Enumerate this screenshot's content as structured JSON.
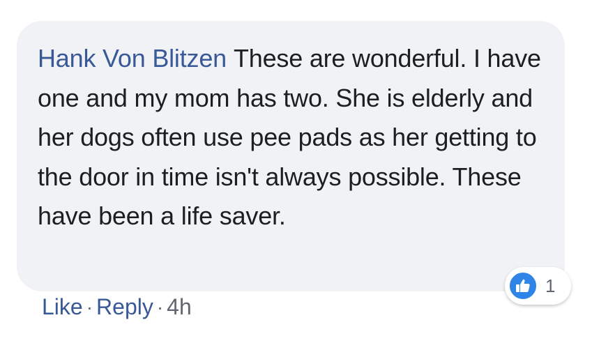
{
  "comment": {
    "author": "Hank Von Blitzen",
    "text": "These are wonderful. I have one and my mom has two. She is elderly and her dogs often use pee pads as her getting to the door in time isn't always possible. These have been a life saver."
  },
  "reactions": {
    "icon": "thumbs-up-icon",
    "count": "1",
    "color": "#2e84e7"
  },
  "actions": {
    "like_label": "Like",
    "separator": "·",
    "reply_label": "Reply",
    "timestamp": "4h"
  },
  "colors": {
    "link": "#385898",
    "bubble": "#f0f2f5",
    "text": "#1c1e21",
    "muted": "#606770"
  }
}
